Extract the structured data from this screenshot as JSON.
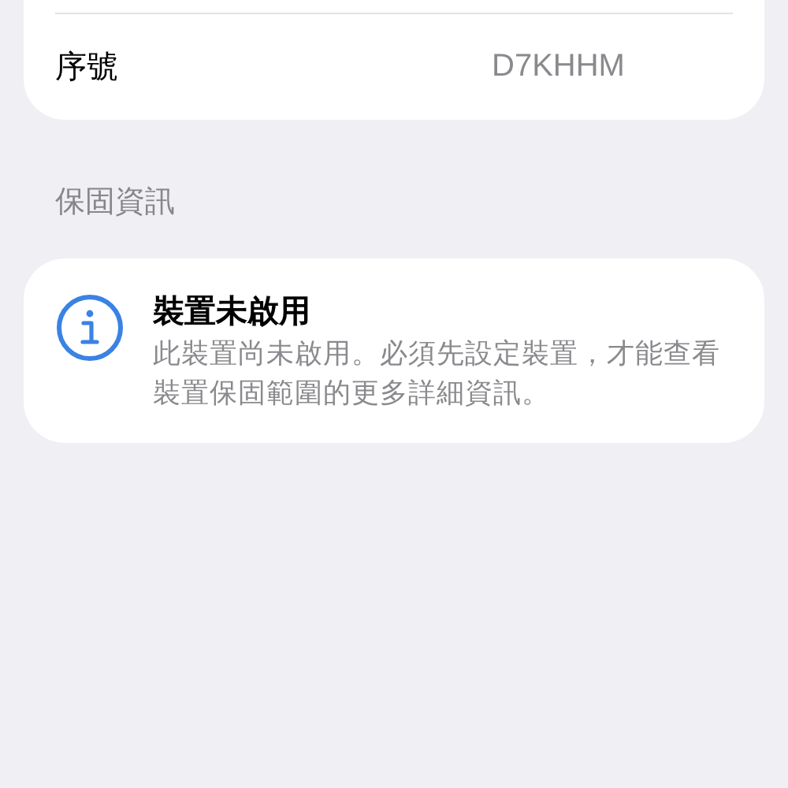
{
  "device_card": {
    "rows": [
      {
        "label": "序號",
        "value": "D7KHHM"
      }
    ]
  },
  "warranty_section": {
    "header": "保固資訊",
    "notice": {
      "title": "裝置未啟用",
      "body": "此裝置尚未啟用。必須先設定裝置，才能查看裝置保固範圍的更多詳細資訊。"
    }
  }
}
